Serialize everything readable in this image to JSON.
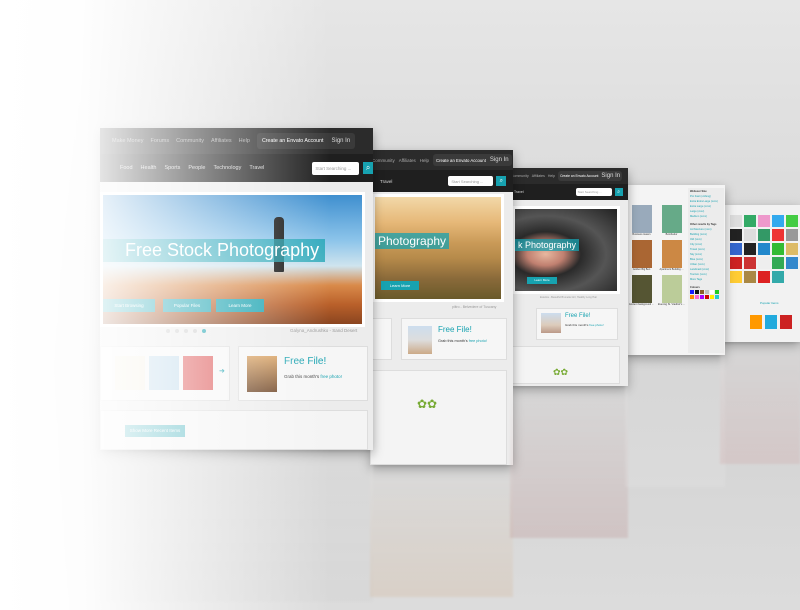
{
  "panel1": {
    "top_nav": [
      "Make Money",
      "Forums",
      "Community",
      "Affiliates",
      "Help"
    ],
    "create_account": "Create an Envato Account",
    "sign_in": "Sign In",
    "categories": [
      "Food",
      "Health",
      "Sports",
      "People",
      "Technology",
      "Travel"
    ],
    "search_placeholder": "Start Searching ...",
    "hero_title": "Free Stock Photography",
    "hero_buttons": [
      "Start Browsing",
      "Popular Files",
      "Learn More"
    ],
    "caption": "Galyna_Andrushko - Sand Desert",
    "free_file_title": "Free File!",
    "free_file_text": "Grab this month's",
    "free_file_link": "free photo!",
    "recent_button": "Show More Recent Items"
  },
  "panel2": {
    "top_nav": [
      "Community",
      "Affiliates",
      "Help"
    ],
    "create_account": "Create an Envato Account",
    "sign_in": "Sign In",
    "categories": [
      "Travel"
    ],
    "search_placeholder": "Start Searching ...",
    "hero_title": "Photography",
    "learn_more": "Learn More",
    "caption": "piitro - Belvedere of Tuscany",
    "free_file_title": "Free File!",
    "free_file_text": "Grab this month's",
    "free_file_link": "free photo!"
  },
  "panel3": {
    "top_nav": [
      "Community",
      "Affiliates",
      "Help"
    ],
    "create_account": "Create an Envato Account",
    "sign_in": "Sign In",
    "categories": [
      "Travel"
    ],
    "search_placeholder": "Start Searching ...",
    "hero_title": "k Photography",
    "learn_more": "Learn More",
    "caption": "Estetica - Beautiful Brunette Girl, Healthy Long Hair",
    "free_file_title": "Free File!",
    "free_file_text": "Grab this month's",
    "free_file_link": "free photo!"
  },
  "panel4": {
    "items": [
      "Business towers",
      "Borobudur",
      "Golden Big Ben",
      "Apartment Building ...",
      "Ancient background ...",
      "Evening St. Vladimir's ..."
    ],
    "sidebar_heading": "Webscer Size",
    "sizes": [
      "Pro Fast (x-Meng)",
      "Extra Extra Large (xxxx)",
      "Extra Large (xxxx)",
      "Large (xxxx)",
      "Medium (xxxx)"
    ],
    "tags_heading": "Other results by Tags",
    "tags": [
      "Architecture (xxxx)",
      "Building (xxxx)",
      "Old (xxxx)",
      "City (xxxx)",
      "Travel (xxxx)",
      "Sky (xxxx)",
      "Blue (xxxx)",
      "Urban (xxxx)",
      "Landmark (xxxx)",
      "Tourism (xxxx)",
      "More Tags"
    ],
    "colours_heading": "Colours",
    "colours": [
      "#1a1aff",
      "#111111",
      "#8a5a2a",
      "#c0c0c0",
      "#ffffff",
      "#22cc22",
      "#ff8800",
      "#ff66cc",
      "#aa00ff",
      "#cc0000",
      "#ffee00",
      "#22cccc"
    ]
  },
  "panel5": {
    "icon_colors": [
      "#ddd",
      "#3a6",
      "#e9c",
      "#3ae",
      "#4c4",
      "#222",
      "#ddd",
      "#396",
      "#e33",
      "#999",
      "#36c",
      "#222",
      "#28c",
      "#3b3",
      "#db6",
      "#c22",
      "#c33",
      "#eee",
      "#3a5",
      "#38c",
      "#fc3",
      "#a84",
      "#d22",
      "#3aa"
    ],
    "link_text": "Popular Items"
  },
  "colors": {
    "accent": "#17a2b0",
    "dark_bar": "#2b2b2b"
  }
}
